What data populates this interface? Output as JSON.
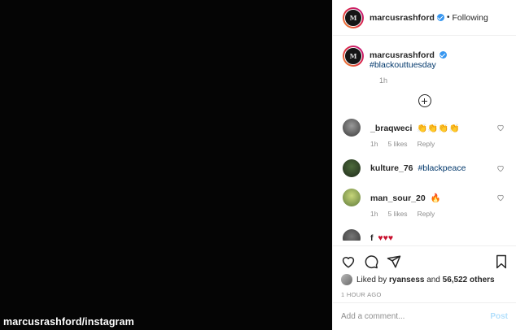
{
  "media": {
    "watermark": "marcusrashford/instagram"
  },
  "header": {
    "username": "marcusrashford",
    "separator": "•",
    "follow_state": "Following"
  },
  "caption": {
    "username": "marcusrashford",
    "hashtag": "#blackouttuesday",
    "time": "1h"
  },
  "comments": [
    {
      "username": "_braqweci",
      "text": "👏👏👏👏",
      "time": "1h",
      "likes": "5 likes",
      "reply": "Reply",
      "avatar_color": "#6b6b6b"
    },
    {
      "username": "kulture_76",
      "text": "#blackpeace",
      "time": "",
      "likes": "",
      "reply": "",
      "avatar_color": "#3a4a34"
    },
    {
      "username": "man_sour_20",
      "text": "🔥",
      "time": "1h",
      "likes": "5 likes",
      "reply": "Reply",
      "avatar_color": "#8fa35c"
    },
    {
      "username": "f",
      "text": "♥♥♥",
      "time": "",
      "likes": "",
      "reply": "",
      "avatar_color": "#555555"
    }
  ],
  "actions": {
    "liked_prefix": "Liked by",
    "liked_user": "ryansess",
    "liked_and": "and",
    "liked_others": "56,522 others",
    "time_ago": "1 HOUR AGO"
  },
  "add_comment": {
    "placeholder": "Add a comment...",
    "post_label": "Post"
  },
  "colors": {
    "link": "#00376b",
    "verified": "#3897f0",
    "muted": "#8e8e8e",
    "post_disabled": "#b2dffc"
  }
}
